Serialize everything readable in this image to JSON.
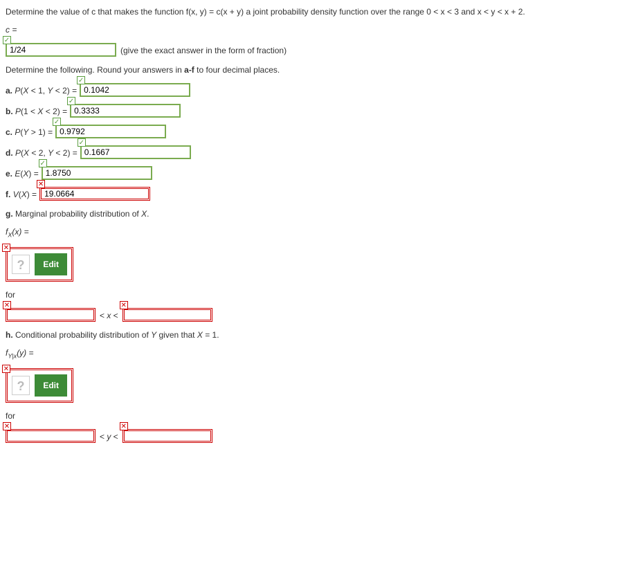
{
  "question": {
    "intro": "Determine the value of c that makes the function f(x, y) = c(x + y) a joint probability density function over the range 0 < x < 3 and x < y < x + 2.",
    "c_label": "c =",
    "c_value": "1/24",
    "c_hint": "(give the exact answer in the form of fraction)",
    "determine_text": "Determine the following. Round your answers in a-f to four decimal places.",
    "parts": {
      "a": {
        "label": "a. P(X < 1, Y < 2) =",
        "value": "0.1042",
        "status": "correct"
      },
      "b": {
        "label": "b. P(1 < X < 2) =",
        "value": "0.3333",
        "status": "correct"
      },
      "c": {
        "label": "c. P(Y > 1) =",
        "value": "0.9792",
        "status": "correct"
      },
      "d": {
        "label": "d. P(X < 2, Y < 2) =",
        "value": "0.1667",
        "status": "correct"
      },
      "e": {
        "label": "e. E(X) =",
        "value": "1.8750",
        "status": "correct"
      },
      "f": {
        "label": "f. V(X) =",
        "value": "19.0664",
        "status": "incorrect"
      }
    },
    "g": {
      "label": "g. Marginal probability distribution of X.",
      "func_label": "fX(x) =",
      "edit_label": "Edit",
      "for_label": "for",
      "range_text": "< x <"
    },
    "h": {
      "label": "h. Conditional probability distribution of Y given that X = 1.",
      "func_label": "fY|x(y) =",
      "edit_label": "Edit",
      "for_label": "for",
      "range_text": "< y <"
    }
  },
  "icons": {
    "check": "✓",
    "cross": "✕",
    "question": "?"
  }
}
